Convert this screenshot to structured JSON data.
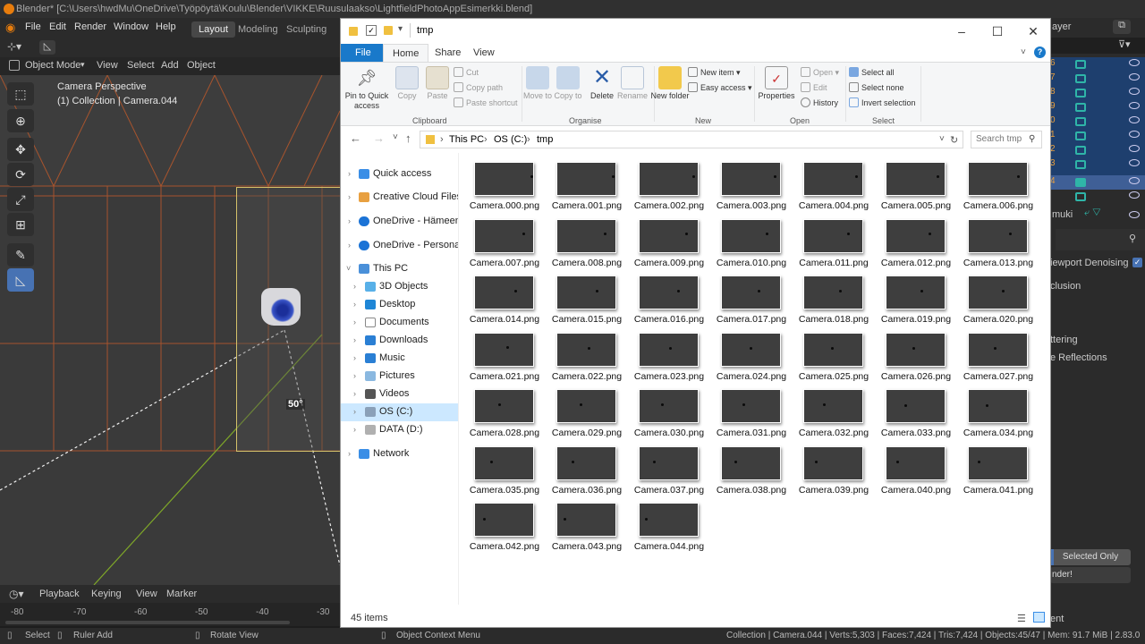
{
  "blender": {
    "title": "Blender* [C:\\Users\\hwdMu\\OneDrive\\Työpöytä\\Koulu\\Blender\\VIKKE\\Ruusulaakso\\LightfieldPhotoAppEsimerkki.blend]",
    "menu": [
      "File",
      "Edit",
      "Render",
      "Window",
      "Help"
    ],
    "workspaces": [
      "Layout",
      "Modeling",
      "Sculpting"
    ],
    "header": {
      "mode": "Object Mode",
      "view": "View",
      "select": "Select",
      "add": "Add",
      "object": "Object"
    },
    "overlay": {
      "line1": "Camera Perspective",
      "line2": "(1) Collection | Camera.044",
      "angle": "50°"
    },
    "timeline": {
      "playback": "Playback",
      "keying": "Keying",
      "view": "View",
      "marker": "Marker",
      "ticks": [
        "-80",
        "-70",
        "-60",
        "-50",
        "-40",
        "-30"
      ]
    },
    "status": {
      "select": "Select",
      "ruler": "Ruler Add",
      "rotate": "Rotate View",
      "context": "Object Context Menu",
      "stats": "Collection | Camera.044 | Verts:5,303 | Faces:7,424 | Tris:7,424 | Objects:45/47 | Mem: 91.7 MiB | 2.83.0"
    },
    "right": {
      "layer": "ayer",
      "outliner_nums": [
        "6",
        "7",
        "8",
        "9",
        "0",
        "1",
        "2",
        "3",
        "4"
      ],
      "muki": "muki",
      "denoise": "iewport Denoising",
      "occlusion": "clusion",
      "scattering": "ttering",
      "reflections": "e Reflections",
      "selected_only": "Selected Only",
      "render": "nder!",
      "ent": "ent"
    }
  },
  "explorer": {
    "title": "tmp",
    "tabs": [
      "File",
      "Home",
      "Share",
      "View"
    ],
    "ribbon": {
      "pin": "Pin to Quick access",
      "copy": "Copy",
      "paste": "Paste",
      "cut": "Cut",
      "copy_path": "Copy path",
      "paste_shortcut": "Paste shortcut",
      "move_to": "Move to",
      "copy_to": "Copy to",
      "delete": "Delete",
      "rename": "Rename",
      "new_folder": "New folder",
      "new_item": "New item",
      "easy_access": "Easy access",
      "properties": "Properties",
      "open": "Open",
      "edit": "Edit",
      "history": "History",
      "select_all": "Select all",
      "select_none": "Select none",
      "invert": "Invert selection",
      "groups": {
        "clipboard": "Clipboard",
        "organise": "Organise",
        "new": "New",
        "open": "Open",
        "select": "Select"
      }
    },
    "address": {
      "this_pc": "This PC",
      "drive": "OS (C:)",
      "folder": "tmp"
    },
    "search_placeholder": "Search tmp",
    "nav": {
      "quick_access": "Quick access",
      "creative_cloud": "Creative Cloud Files",
      "onedrive_hameen": "OneDrive - Hämeen a",
      "onedrive_personal": "OneDrive - Personal",
      "this_pc": "This PC",
      "objects3d": "3D Objects",
      "desktop": "Desktop",
      "documents": "Documents",
      "downloads": "Downloads",
      "music": "Music",
      "pictures": "Pictures",
      "videos": "Videos",
      "os_c": "OS (C:)",
      "data_d": "DATA (D:)",
      "network": "Network"
    },
    "files": [
      "Camera.000.png",
      "Camera.001.png",
      "Camera.002.png",
      "Camera.003.png",
      "Camera.004.png",
      "Camera.005.png",
      "Camera.006.png",
      "Camera.007.png",
      "Camera.008.png",
      "Camera.009.png",
      "Camera.010.png",
      "Camera.011.png",
      "Camera.012.png",
      "Camera.013.png",
      "Camera.014.png",
      "Camera.015.png",
      "Camera.016.png",
      "Camera.017.png",
      "Camera.018.png",
      "Camera.019.png",
      "Camera.020.png",
      "Camera.021.png",
      "Camera.022.png",
      "Camera.023.png",
      "Camera.024.png",
      "Camera.025.png",
      "Camera.026.png",
      "Camera.027.png",
      "Camera.028.png",
      "Camera.029.png",
      "Camera.030.png",
      "Camera.031.png",
      "Camera.032.png",
      "Camera.033.png",
      "Camera.034.png",
      "Camera.035.png",
      "Camera.036.png",
      "Camera.037.png",
      "Camera.038.png",
      "Camera.039.png",
      "Camera.040.png",
      "Camera.041.png",
      "Camera.042.png",
      "Camera.043.png",
      "Camera.044.png"
    ],
    "item_count": "45 items"
  },
  "colors": {
    "blender_orange": "#e87d0d",
    "explorer_blue": "#1979ca",
    "selection": "#cce8ff"
  }
}
